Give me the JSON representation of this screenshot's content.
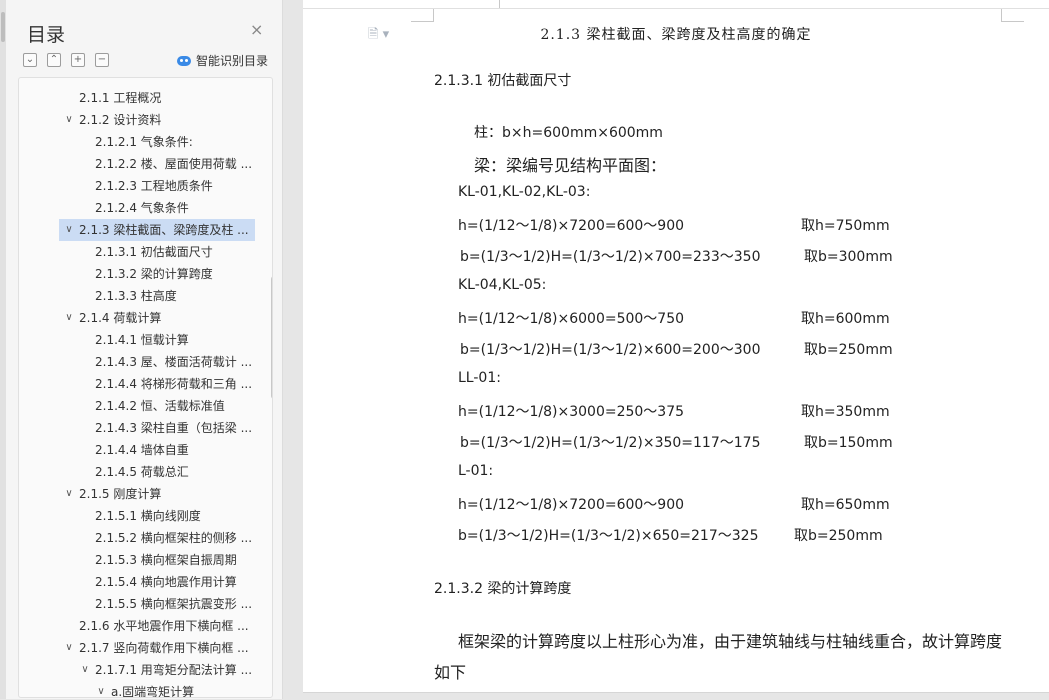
{
  "toc": {
    "title": "目录",
    "close_symbol": "×",
    "toolbar": {
      "collapse_all_symbol": "⌄",
      "expand_up_symbol": "⌃",
      "add_symbol": "+",
      "remove_symbol": "−",
      "smart_label": "智能识别目录"
    },
    "items": [
      {
        "label": "2.1.1  工程概况",
        "level": 1,
        "chev": ""
      },
      {
        "label": "2.1.2  设计资料",
        "level": 1,
        "chev": "∨"
      },
      {
        "label": "2.1.2.1 气象条件:",
        "level": 2,
        "chev": ""
      },
      {
        "label": "2.1.2.2 楼、屋面使用荷载 ...",
        "level": 2,
        "chev": ""
      },
      {
        "label": "2.1.2.3  工程地质条件",
        "level": 2,
        "chev": ""
      },
      {
        "label": "2.1.2.4  气象条件",
        "level": 2,
        "chev": ""
      },
      {
        "label": "2.1.3  梁柱截面、梁跨度及柱 ...",
        "level": 1,
        "chev": "∨",
        "active": true
      },
      {
        "label": "2.1.3.1  初估截面尺寸",
        "level": 2,
        "chev": ""
      },
      {
        "label": "2.1.3.2  梁的计算跨度",
        "level": 2,
        "chev": ""
      },
      {
        "label": "2.1.3.3  柱高度",
        "level": 2,
        "chev": ""
      },
      {
        "label": "2.1.4  荷载计算",
        "level": 1,
        "chev": "∨"
      },
      {
        "label": "2.1.4.1 恒载计算",
        "level": 2,
        "chev": ""
      },
      {
        "label": "2.1.4.3 屋、楼面活荷载计 ...",
        "level": 2,
        "chev": ""
      },
      {
        "label": "2.1.4.4  将梯形荷载和三角 ...",
        "level": 2,
        "chev": ""
      },
      {
        "label": "2.1.4.2 恒、活载标准值",
        "level": 2,
        "chev": ""
      },
      {
        "label": "2.1.4.3  梁柱自重（包括梁 ...",
        "level": 2,
        "chev": ""
      },
      {
        "label": "2.1.4.4  墙体自重",
        "level": 2,
        "chev": ""
      },
      {
        "label": "2.1.4.5 荷载总汇",
        "level": 2,
        "chev": ""
      },
      {
        "label": "2.1.5  刚度计算",
        "level": 1,
        "chev": "∨"
      },
      {
        "label": "2.1.5.1  横向线刚度",
        "level": 2,
        "chev": ""
      },
      {
        "label": "2.1.5.2  横向框架柱的侧移 ...",
        "level": 2,
        "chev": ""
      },
      {
        "label": "2.1.5.3  横向框架自振周期",
        "level": 2,
        "chev": ""
      },
      {
        "label": "2.1.5.4  横向地震作用计算",
        "level": 2,
        "chev": ""
      },
      {
        "label": "2.1.5.5  横向框架抗震变形 ...",
        "level": 2,
        "chev": ""
      },
      {
        "label": "2.1.6  水平地震作用下横向框 ...",
        "level": 1,
        "chev": ""
      },
      {
        "label": "2.1.7  竖向荷载作用下横向框 ...",
        "level": 1,
        "chev": "∨"
      },
      {
        "label": "2.1.7.1 用弯矩分配法计算 ...",
        "level": 2,
        "chev": "∨"
      },
      {
        "label": "a.固端弯矩计算",
        "level": 3,
        "chev": "∨"
      }
    ]
  },
  "document": {
    "header_icon": "doc-icon",
    "running_header": "2.1.3  梁柱截面、梁跨度及柱高度的确定",
    "section_1": "2.1.3.1  初估截面尺寸",
    "column_line": "柱：b×h=600mm×600mm",
    "beam_line": "梁：梁编号见结构平面图：",
    "groups": [
      {
        "name": "KL-01,KL-02,KL-03:",
        "h_formula": "h=(1/12～1/8)×7200=600～900",
        "h_take": "取h=750mm",
        "b_formula": "b=(1/3～1/2)H=(1/3～1/2)×700=233～350",
        "b_take": "取b=300mm"
      },
      {
        "name": "KL-04,KL-05:",
        "h_formula": "h=(1/12～1/8)×6000=500～750",
        "h_take": "取h=600mm",
        "b_formula": "b=(1/3～1/2)H=(1/3～1/2)×600=200～300",
        "b_take": "取b=250mm"
      },
      {
        "name": "LL-01:",
        "h_formula": "h=(1/12～1/8)×3000=250～375",
        "h_take": "取h=350mm",
        "b_formula": "b=(1/3～1/2)H=(1/3～1/2)×350=117～175",
        "b_take": "取b=150mm"
      },
      {
        "name": "L-01:",
        "h_formula": "h=(1/12～1/8)×7200=600～900",
        "h_take": "取h=650mm",
        "b_formula": "b=(1/3～1/2)H=(1/3～1/2)×650=217～325",
        "b_take": "取b=250mm"
      }
    ],
    "section_2": "2.1.3.2  梁的计算跨度",
    "para_line1": "框架梁的计算跨度以上柱形心为准，由于建筑轴线与柱轴线重合，故计算跨度",
    "para_line2": "如下"
  }
}
